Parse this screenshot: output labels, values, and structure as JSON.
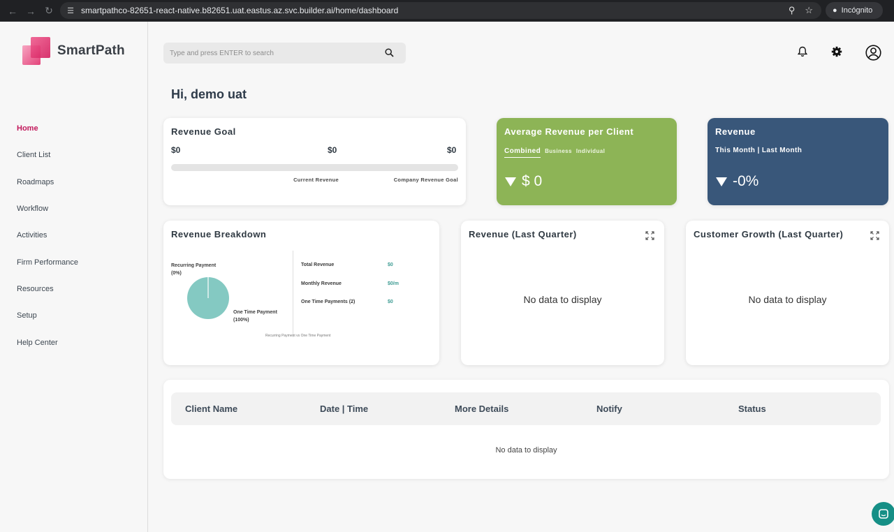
{
  "browser": {
    "url": "smartpathco-82651-react-native.b82651.uat.eastus.az.svc.builder.ai/home/dashboard",
    "incognito_label": "Incógnito"
  },
  "app": {
    "logo_text": "SmartPath"
  },
  "sidebar": {
    "items": [
      {
        "label": "Home",
        "active": true
      },
      {
        "label": "Client List"
      },
      {
        "label": "Roadmaps"
      },
      {
        "label": "Workflow"
      },
      {
        "label": "Activities"
      },
      {
        "label": "Firm Performance"
      },
      {
        "label": "Resources"
      },
      {
        "label": "Setup"
      },
      {
        "label": "Help Center"
      }
    ]
  },
  "header": {
    "search_placeholder": "Type and press ENTER to search",
    "icons": [
      "bell-icon",
      "gear-icon",
      "user-avatar-icon"
    ]
  },
  "greeting": "Hi, demo uat",
  "revenue_goal": {
    "title": "Revenue Goal",
    "start_value": "$0",
    "current_value": "$0",
    "goal_value": "$0",
    "progress_fraction": 0,
    "current_label": "Current Revenue",
    "goal_label": "Company Revenue Goal"
  },
  "avg_revenue": {
    "title": "Average Revenue per Client",
    "tabs": [
      "Combined",
      "Business",
      "Individual"
    ],
    "active_tab": "Combined",
    "value": "$ 0",
    "color": "#8db456"
  },
  "revenue": {
    "title": "Revenue",
    "period": "This Month | Last Month",
    "value": "-0%",
    "color": "#39577a"
  },
  "breakdown": {
    "title": "Revenue Breakdown",
    "recurring_label": "Recurring Payment (0%)",
    "one_time_label": "One Time Payment (100%)",
    "rows": [
      {
        "label": "Total Revenue",
        "value": "$0"
      },
      {
        "label": "Monthly Revenue",
        "value": "$0/m"
      },
      {
        "label": "One Time Payments (2)",
        "value": "$0"
      }
    ],
    "caption": "Recurring Payment vs One Time Payment",
    "pie_color": "#84c9c2"
  },
  "chart_data": {
    "type": "pie",
    "categories": [
      "Recurring Payment",
      "One Time Payment"
    ],
    "values": [
      0,
      100
    ]
  },
  "last_quarter": {
    "title": "Revenue (Last Quarter)",
    "empty": "No data to display"
  },
  "customer_growth": {
    "title": "Customer Growth (Last Quarter)",
    "empty": "No data to display"
  },
  "table": {
    "columns": [
      "Client Name",
      "Date | Time",
      "More Details",
      "Notify",
      "Status"
    ],
    "empty": "No data to display"
  }
}
